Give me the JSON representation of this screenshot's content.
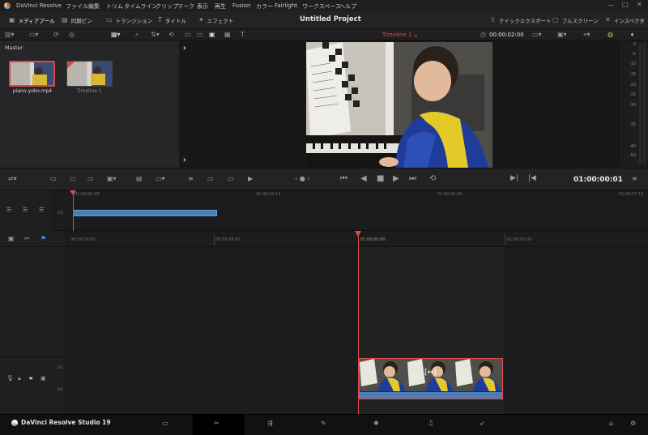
{
  "app": {
    "name": "DaVinci Resolve",
    "project_title": "Untitled Project"
  },
  "menu": [
    "ファイル",
    "編集",
    "トリム",
    "タイムライン",
    "クリップ",
    "マーク",
    "表示",
    "再生",
    "Fusion",
    "カラー",
    "Fairlight",
    "ワークスペース",
    "ヘルプ"
  ],
  "toolbar": {
    "media_pool": "メディアプール",
    "sync_bin": "同期ビン",
    "transitions": "トランジション",
    "titles": "タイトル",
    "effects": "エフェクト",
    "quick_export": "クイックエクスポート",
    "fullscreen": "フルスクリーン",
    "inspector": "インスペクタ"
  },
  "viewer_bar": {
    "timeline_name": "Timeline 1",
    "timecode": "00:00:02:00"
  },
  "media_pool": {
    "bin": "Master",
    "clips": [
      {
        "name": "piano-yoko.mp4"
      },
      {
        "name": "Timeline 1"
      }
    ]
  },
  "meters": {
    "scale": [
      "0",
      "-5",
      "-10",
      "-15",
      "-20",
      "-25",
      "-30",
      "-35",
      "-40",
      "-50"
    ]
  },
  "transport": {
    "timecode": "01:00:00:01"
  },
  "upper_timeline": {
    "ticks": [
      "01:00:00:00",
      "01:00:02:12",
      "01:00:05:00",
      "01:00:07:12"
    ],
    "track": "V1"
  },
  "lower_timeline": {
    "ticks": [
      "00:59:56:00",
      "00:59:58:00",
      "01:00:00:00",
      "01:00:02:00"
    ],
    "tracks": [
      "V1",
      "A1"
    ]
  },
  "bottom": {
    "brand": "DaVinci Resolve Studio 19"
  },
  "colors": {
    "accent_red": "#e04a4a",
    "clip_blue": "#4a7fb5",
    "background": "#1c1c1e"
  }
}
